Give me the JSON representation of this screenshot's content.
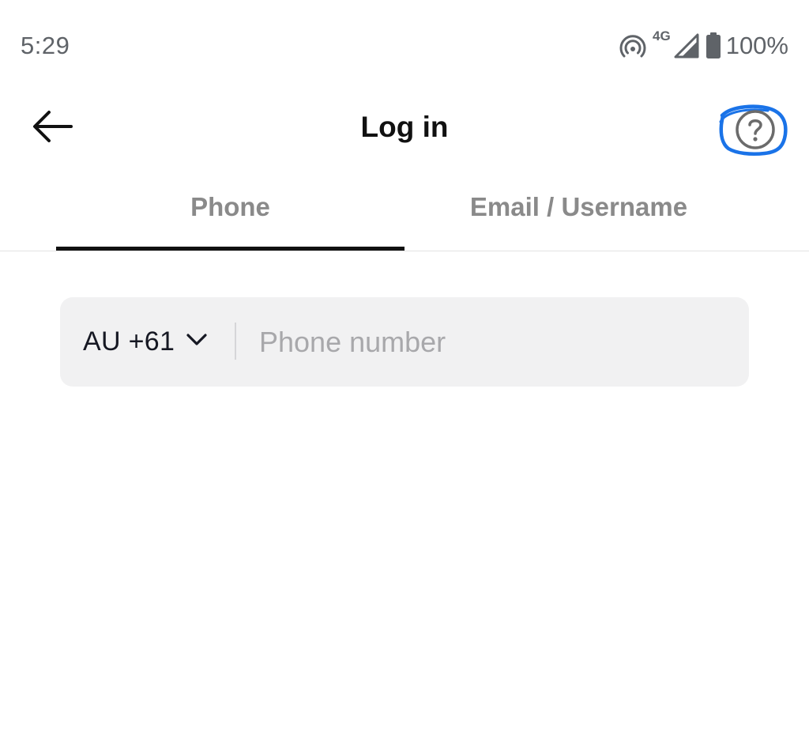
{
  "status_bar": {
    "time": "5:29",
    "network_label": "4G",
    "battery_percent": "100%",
    "icons": [
      "hotspot-icon",
      "cellular-signal-icon",
      "battery-icon"
    ]
  },
  "header": {
    "title": "Log in",
    "back_icon": "arrow-left-icon",
    "help_icon": "question-circle-icon",
    "help_annotation_color": "#1a73e8"
  },
  "tabs": [
    {
      "label": "Phone",
      "selected": true
    },
    {
      "label": "Email / Username",
      "selected": false
    }
  ],
  "phone_form": {
    "country_code": "AU +61",
    "phone_value": "",
    "phone_placeholder": "Phone number"
  },
  "colors": {
    "text_primary": "#161823",
    "tab_inactive": "#8a8a8a",
    "input_bg": "#f1f1f2",
    "indicator": "#111111"
  }
}
